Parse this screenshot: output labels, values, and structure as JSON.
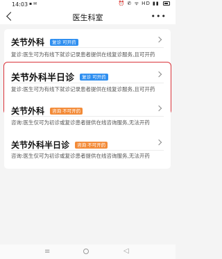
{
  "status_bar": {
    "time": "14:03",
    "left_icons": "▪ ✉",
    "right_icons": "⏰ ✆ ᯤ HD ▮▮"
  },
  "header": {
    "title": "医生科室",
    "more": "•••"
  },
  "departments": [
    {
      "name": "关节外科",
      "badge": "复诊 可开药",
      "badge_color": "#2f8ff0",
      "description": "复诊:医生可为有线下就诊记录患者提供在线复诊服务,且可开药"
    },
    {
      "name": "关节外科半日诊",
      "badge": "复诊 可开药",
      "badge_color": "#2f8ff0",
      "description": "复诊:医生可为有线下就诊记录患者提供在线复诊服务,且可开药"
    },
    {
      "name": "关节外科",
      "badge": "咨询 不可开药",
      "badge_color": "#f38b38",
      "description": "咨询:医生仅可为初诊或复诊患者提供在线咨询服务,无法开药"
    },
    {
      "name": "关节外科半日诊",
      "badge": "咨询 不可开药",
      "badge_color": "#f38b38",
      "description": "咨询:医生仅可为初诊或复诊患者提供在线咨询服务,无法开药"
    }
  ],
  "system_nav": {
    "menu": "≡",
    "back": "◁"
  }
}
